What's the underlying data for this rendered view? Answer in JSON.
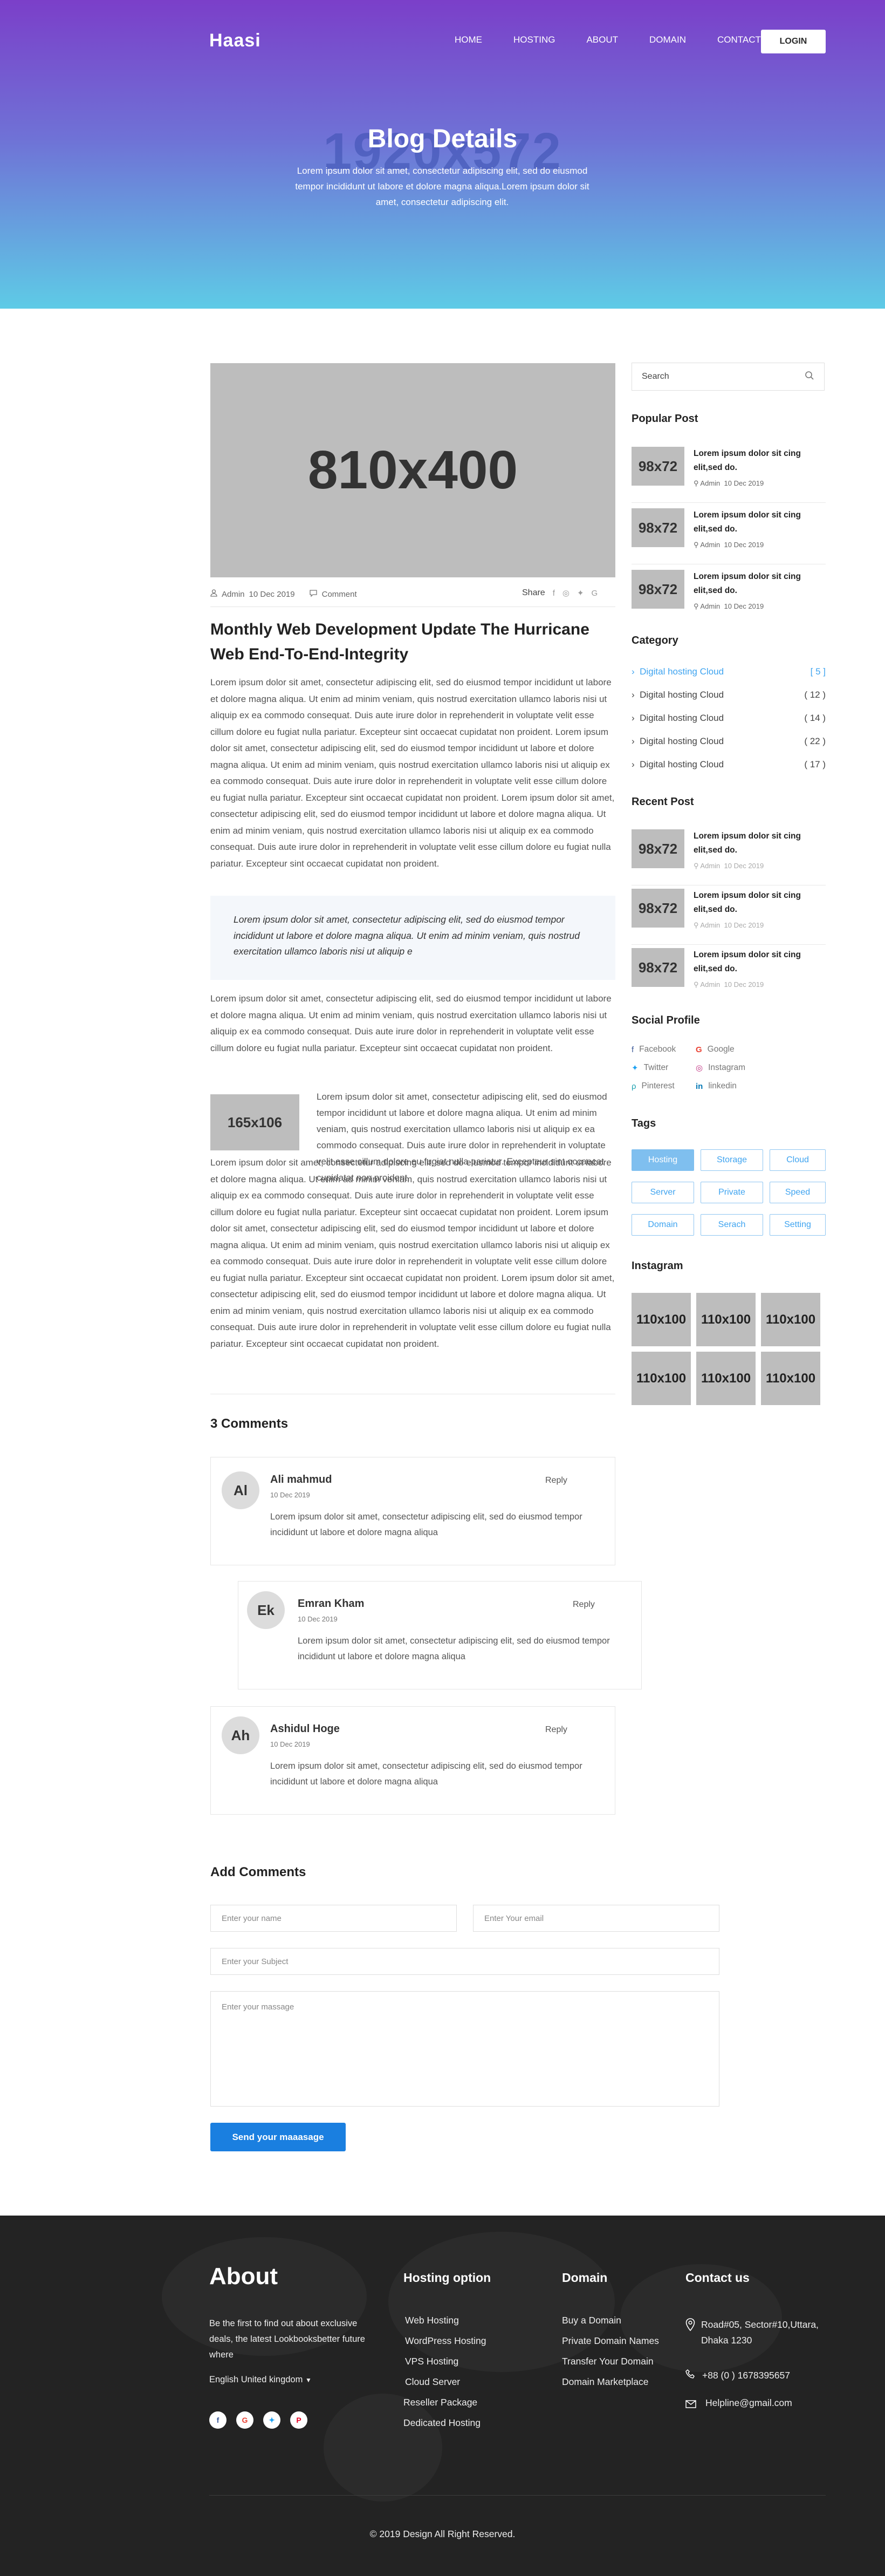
{
  "header": {
    "logo": "Haasi",
    "nav": [
      "HOME",
      "HOSTING",
      "ABOUT",
      "DOMAIN",
      "CONTACT"
    ],
    "login": "LOGIN",
    "hero_placeholder": "1920x572",
    "title": "Blog Details",
    "subtitle": "Lorem ipsum dolor sit amet, consectetur adipiscing elit, sed do eiusmod tempor incididunt ut labore et dolore magna aliqua.Lorem ipsum dolor sit amet, consectetur adipiscing elit."
  },
  "post": {
    "image_label": "810x400",
    "author": "Admin",
    "date": "10 Dec 2019",
    "comment_label": "Comment",
    "share_label": "Share",
    "title": "Monthly Web Development Update The Hurricane Web End-To-End-Integrity",
    "para1": "Lorem ipsum dolor sit amet, consectetur adipiscing elit, sed do eiusmod tempor incididunt ut labore et dolore magna aliqua. Ut enim ad minim veniam, quis nostrud exercitation ullamco laboris nisi ut aliquip ex ea commodo consequat. Duis aute irure dolor in reprehenderit in voluptate velit esse cillum dolore eu fugiat nulla pariatur. Excepteur sint occaecat cupidatat non proident. Lorem ipsum dolor sit amet, consectetur adipiscing elit, sed do eiusmod tempor incididunt ut labore et dolore magna aliqua. Ut enim ad minim veniam, quis nostrud exercitation ullamco laboris nisi ut aliquip ex ea commodo consequat. Duis aute irure dolor in reprehenderit in voluptate velit esse cillum dolore eu fugiat nulla pariatur. Excepteur sint occaecat cupidatat non proident. Lorem ipsum dolor sit amet, consectetur adipiscing elit, sed do eiusmod tempor incididunt ut labore et dolore magna aliqua. Ut enim ad minim veniam, quis nostrud exercitation ullamco laboris nisi ut aliquip ex ea commodo consequat. Duis aute irure dolor in reprehenderit in voluptate velit esse cillum dolore eu fugiat nulla pariatur. Excepteur sint occaecat cupidatat non proident.",
    "quote": "Lorem ipsum dolor sit amet, consectetur adipiscing elit, sed do eiusmod tempor incididunt ut labore et dolore magna aliqua. Ut enim ad minim veniam, quis nostrud exercitation ullamco laboris nisi ut aliquip e",
    "para2": "Lorem ipsum dolor sit amet, consectetur adipiscing elit, sed do eiusmod tempor incididunt ut labore et dolore magna aliqua. Ut enim ad minim veniam, quis nostrud exercitation ullamco laboris nisi ut aliquip ex ea commodo consequat. Duis aute irure dolor in reprehenderit in voluptate velit esse cillum dolore eu fugiat nulla pariatur. Excepteur sint occaecat cupidatat non proident.",
    "small_image_label": "165x106",
    "para3": "Lorem ipsum dolor sit amet, consectetur adipiscing elit, sed do eiusmod tempor incididunt ut labore et dolore magna aliqua. Ut enim ad minim veniam, quis nostrud exercitation ullamco laboris nisi ut aliquip ex ea commodo consequat. Duis aute irure dolor in reprehenderit in voluptate velit esse cillum dolore eu fugiat nulla pariatur. Excepteur sint occaecat cupidatat non proident.",
    "para4": "Lorem ipsum dolor sit amet, consectetur adipiscing elit, sed do eiusmod tempor incididunt ut labore et dolore magna aliqua. Ut enim ad minim veniam, quis nostrud exercitation ullamco laboris nisi ut aliquip ex ea commodo consequat. Duis aute irure dolor in reprehenderit in voluptate velit esse cillum dolore eu fugiat nulla pariatur. Excepteur sint occaecat cupidatat non proident. Lorem ipsum dolor sit amet, consectetur adipiscing elit, sed do eiusmod tempor incididunt ut labore et dolore magna aliqua. Ut enim ad minim veniam, quis nostrud exercitation ullamco laboris nisi ut aliquip ex ea commodo consequat. Duis aute irure dolor in reprehenderit in voluptate velit esse cillum dolore eu fugiat nulla pariatur. Excepteur sint occaecat cupidatat non proident. Lorem ipsum dolor sit amet, consectetur adipiscing elit, sed do eiusmod tempor incididunt ut labore et dolore magna aliqua. Ut enim ad minim veniam, quis nostrud exercitation ullamco laboris nisi ut aliquip ex ea commodo consequat. Duis aute irure dolor in reprehenderit in voluptate velit esse cillum dolore eu fugiat nulla pariatur. Excepteur sint occaecat cupidatat non proident."
  },
  "comments": {
    "title": "3 Comments",
    "items": [
      {
        "initials": "Al",
        "name": "Ali mahmud",
        "date": "10 Dec 2019",
        "reply": "Reply",
        "text": "Lorem ipsum dolor sit amet, consectetur adipiscing elit, sed do eiusmod tempor incididunt ut labore et dolore magna aliqua"
      },
      {
        "initials": "Ek",
        "name": "Emran Kham",
        "date": "10 Dec 2019",
        "reply": "Reply",
        "text": "Lorem ipsum dolor sit amet, consectetur adipiscing elit, sed do eiusmod tempor incididunt ut labore et dolore magna aliqua"
      },
      {
        "initials": "Ah",
        "name": "Ashidul Hoge",
        "date": "10 Dec 2019",
        "reply": "Reply",
        "text": "Lorem ipsum dolor sit amet, consectetur adipiscing elit, sed do eiusmod tempor incididunt ut labore et dolore magna aliqua"
      }
    ]
  },
  "form": {
    "title": "Add Comments",
    "name_placeholder": "Enter your name",
    "email_placeholder": "Enter Your email",
    "subject_placeholder": "Enter your Subject",
    "message_placeholder": "Enter your massage",
    "submit": "Send your maaasage"
  },
  "sidebar": {
    "search_placeholder": "Search",
    "popular_title": "Popular Post",
    "popular": [
      {
        "thumb": "98x72",
        "title": "Lorem ipsum dolor sit cing elit,sed do.",
        "author": "Admin",
        "date": "10 Dec 2019"
      },
      {
        "thumb": "98x72",
        "title": "Lorem ipsum dolor sit cing elit,sed do.",
        "author": "Admin",
        "date": "10 Dec 2019"
      },
      {
        "thumb": "98x72",
        "title": "Lorem ipsum dolor sit cing elit,sed do.",
        "author": "Admin",
        "date": "10 Dec 2019"
      }
    ],
    "category_title": "Category",
    "categories": [
      {
        "name": "Digital hosting Cloud",
        "count": "[ 5 ]"
      },
      {
        "name": "Digital hosting Cloud",
        "count": "( 12 )"
      },
      {
        "name": "Digital hosting Cloud",
        "count": "( 14 )"
      },
      {
        "name": "Digital hosting Cloud",
        "count": "( 22 )"
      },
      {
        "name": "Digital hosting Cloud",
        "count": "( 17 )"
      }
    ],
    "recent_title": "Recent Post",
    "recent": [
      {
        "thumb": "98x72",
        "title": "Lorem ipsum dolor sit cing elit,sed do.",
        "author": "Admin",
        "date": "10 Dec 2019"
      },
      {
        "thumb": "98x72",
        "title": "Lorem ipsum dolor sit cing elit,sed do.",
        "author": "Admin",
        "date": "10 Dec 2019"
      },
      {
        "thumb": "98x72",
        "title": "Lorem ipsum dolor sit cing elit,sed do.",
        "author": "Admin",
        "date": "10 Dec 2019"
      }
    ],
    "social_title": "Social Profile",
    "social": [
      "Facebook",
      "Google",
      "Twitter",
      "Instagram",
      "Pinterest",
      "linkedin"
    ],
    "tags_title": "Tags",
    "tags": [
      "Hosting",
      "Storage",
      "Cloud",
      "Server",
      "Private",
      "Speed",
      "Domain",
      "Serach",
      "Setting"
    ],
    "instagram_title": "Instagram",
    "instagram": [
      "110x100",
      "110x100",
      "110x100",
      "110x100",
      "110x100",
      "110x100"
    ]
  },
  "footer": {
    "about_title": "About",
    "about_text": "Be the first to find out about exclusive deals, the latest Lookbooksbetter future where",
    "language": "English United kingdom",
    "hosting_title": "Hosting option",
    "hosting_links": [
      "Web Hosting",
      "WordPress Hosting",
      "VPS Hosting",
      "Cloud Server",
      "Reseller Package",
      "Dedicated Hosting"
    ],
    "domain_title": "Domain",
    "domain_links": [
      "Buy a Domain",
      "Private Domain Names",
      "Transfer Your Domain",
      "Domain Marketplace"
    ],
    "contact_title": "Contact us",
    "address": "Road#05, Sector#10,Uttara, Dhaka 1230",
    "phone": "+88 (0 ) 1678395657",
    "email": "Helpline@gmail.com",
    "copyright": "© 2019  Design All Right Reserved."
  },
  "colors": {
    "accent": "#1a7fe0",
    "tag": "#3fa4f0",
    "footer_bg": "#232323",
    "hero_top": "#7b3fc9",
    "hero_bottom": "#5ecbe6"
  }
}
